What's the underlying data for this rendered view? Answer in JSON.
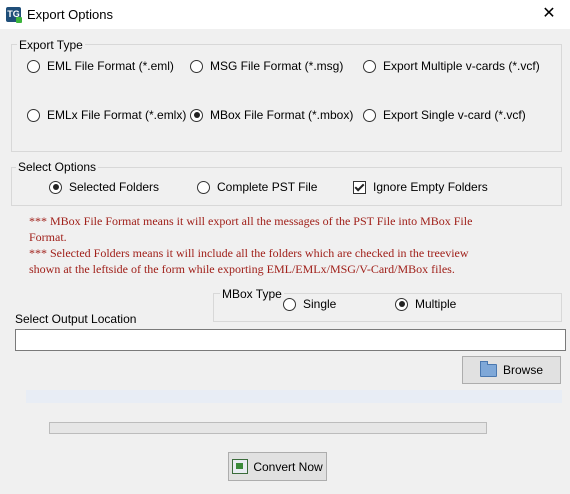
{
  "window": {
    "title": "Export Options",
    "app_icon_letters": "TG"
  },
  "export_type": {
    "legend": "Export Type",
    "options": [
      {
        "label": "EML File  Format (*.eml)",
        "selected": false
      },
      {
        "label": "MSG File Format (*.msg)",
        "selected": false
      },
      {
        "label": "Export Multiple v-cards (*.vcf)",
        "selected": false
      },
      {
        "label": "EMLx File  Format (*.emlx)",
        "selected": false
      },
      {
        "label": "MBox File Format (*.mbox)",
        "selected": true
      },
      {
        "label": "Export Single v-card (*.vcf)",
        "selected": false
      }
    ]
  },
  "select_options": {
    "legend": "Select Options",
    "selected_folders": {
      "label": "Selected Folders",
      "selected": true
    },
    "complete_pst": {
      "label": "Complete PST File",
      "selected": false
    },
    "ignore_empty": {
      "label": "Ignore Empty Folders",
      "checked": true
    }
  },
  "notes": {
    "mbox": "*** MBox File Format means it will export all the messages of the PST File into MBox File Format.",
    "folders": "*** Selected Folders means it will include all the folders which are checked in the treeview shown at the leftside of the form while exporting EML/EMLx/MSG/V-Card/MBox files."
  },
  "mbox_type": {
    "legend": "MBox Type",
    "single": {
      "label": "Single",
      "selected": false
    },
    "multiple": {
      "label": "Multiple",
      "selected": true
    }
  },
  "output": {
    "label": "Select Output Location",
    "value": "",
    "placeholder": ""
  },
  "buttons": {
    "browse": "Browse",
    "convert": "Convert Now"
  },
  "progress": {
    "percent": 0
  },
  "colors": {
    "note_text": "#a0201a",
    "progress_fill": "#06b025"
  }
}
